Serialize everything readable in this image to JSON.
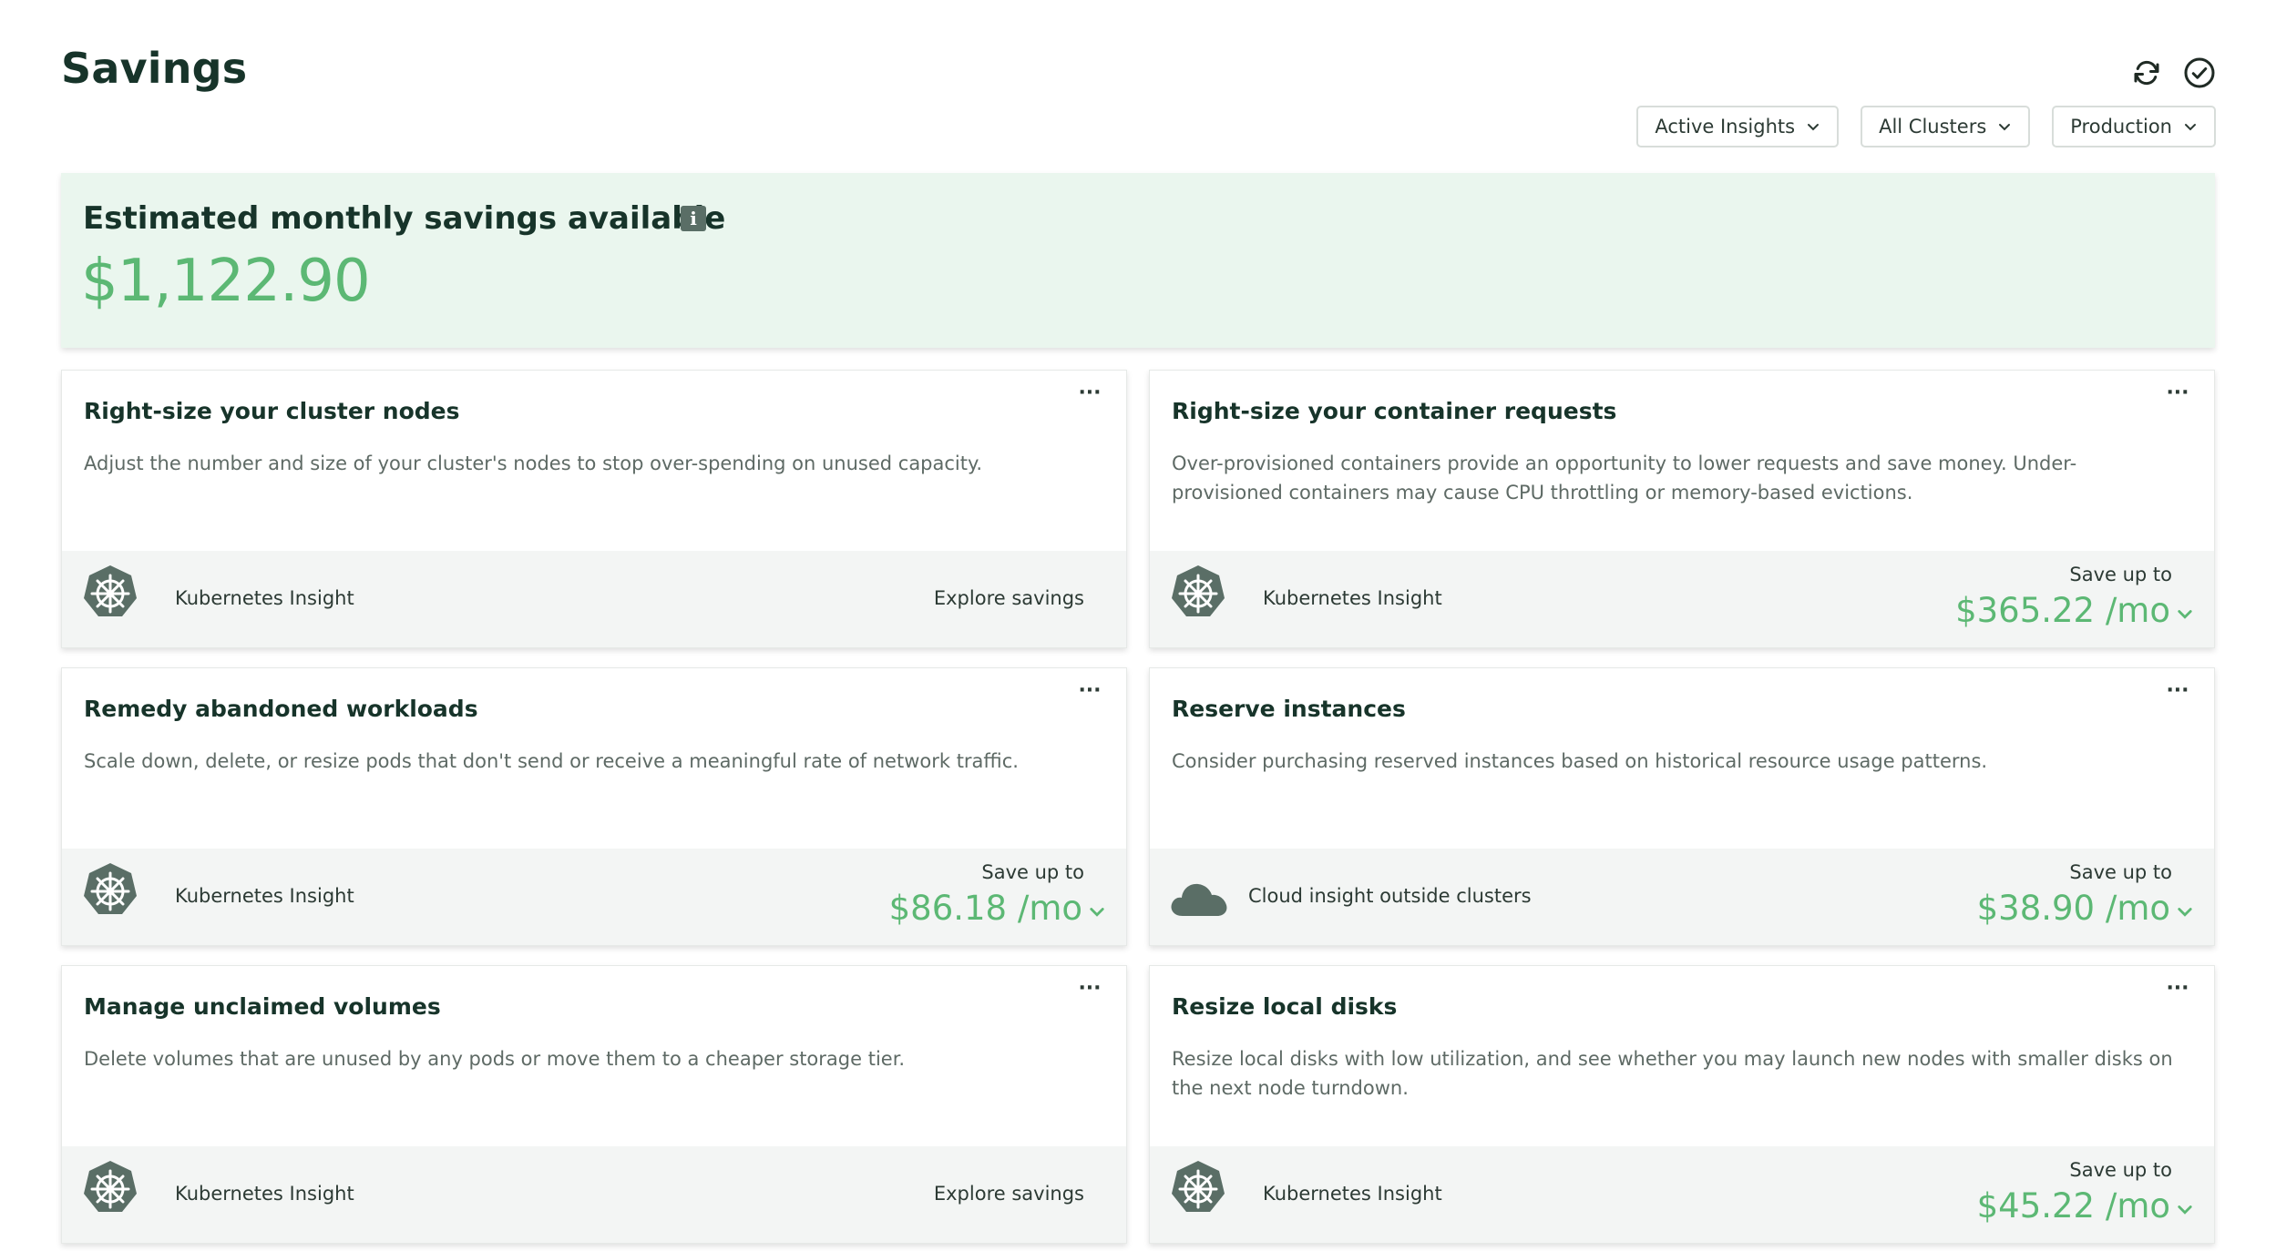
{
  "page": {
    "title": "Savings"
  },
  "header_icons": [
    "refresh-icon",
    "check-circle-icon"
  ],
  "filters": [
    {
      "label": "Active Insights"
    },
    {
      "label": "All Clusters"
    },
    {
      "label": "Production"
    }
  ],
  "banner": {
    "title": "Estimated monthly savings available",
    "amount": "$1,122.90"
  },
  "cards": [
    {
      "title": "Right-size your cluster nodes",
      "description": "Adjust the number and size of your cluster's nodes to stop over-spending on unused capacity.",
      "source": "Kubernetes Insight",
      "source_icon": "kubernetes-icon",
      "action": "Explore savings"
    },
    {
      "title": "Right-size your container requests",
      "description": "Over-provisioned containers provide an opportunity to lower requests and save money. Under-provisioned containers may cause CPU throttling or memory-based evictions.",
      "source": "Kubernetes Insight",
      "source_icon": "kubernetes-icon",
      "save_label": "Save up to",
      "save_amount": "$365.22 /mo"
    },
    {
      "title": "Remedy abandoned workloads",
      "description": "Scale down, delete, or resize pods that don't send or receive a meaningful rate of network traffic.",
      "source": "Kubernetes Insight",
      "source_icon": "kubernetes-icon",
      "save_label": "Save up to",
      "save_amount": "$86.18 /mo"
    },
    {
      "title": "Reserve instances",
      "description": "Consider purchasing reserved instances based on historical resource usage patterns.",
      "source": "Cloud insight outside clusters",
      "source_icon": "cloud-icon",
      "save_label": "Save up to",
      "save_amount": "$38.90 /mo"
    },
    {
      "title": "Manage unclaimed volumes",
      "description": "Delete volumes that are unused by any pods or move them to a cheaper storage tier.",
      "source": "Kubernetes Insight",
      "source_icon": "kubernetes-icon",
      "action": "Explore savings"
    },
    {
      "title": "Resize local disks",
      "description": "Resize local disks with low utilization, and see whether you may launch new nodes with smaller disks on the next node turndown.",
      "source": "Kubernetes Insight",
      "source_icon": "kubernetes-icon",
      "save_label": "Save up to",
      "save_amount": "$45.22 /mo"
    }
  ],
  "colors": {
    "accent_green": "#5cb874",
    "banner_bg": "#eaf6ee",
    "icon_gray": "#5a6e66",
    "title_dark": "#17342a"
  }
}
